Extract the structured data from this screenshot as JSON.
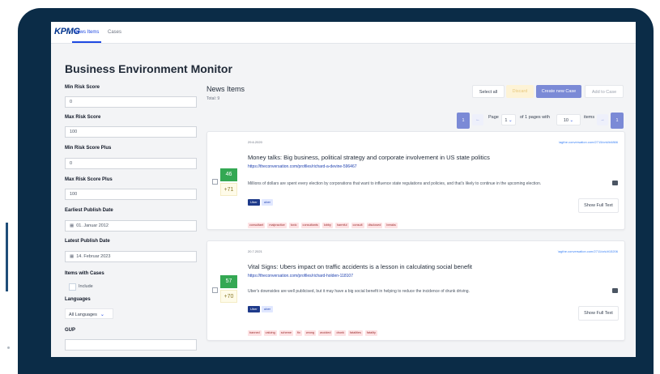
{
  "nav": {
    "logo": "KPMG",
    "tabs": [
      "News Items",
      "Cases"
    ]
  },
  "page_title": "Business Environment Monitor",
  "filters": {
    "min_risk_label": "Min Risk Score",
    "min_risk_value": "0",
    "max_risk_label": "Max Risk Score",
    "max_risk_value": "100",
    "min_risk_plus_label": "Min Risk Score Plus",
    "min_risk_plus_value": "0",
    "max_risk_plus_label": "Max Risk Score Plus",
    "max_risk_plus_value": "100",
    "earliest_label": "Earliest Publish Date",
    "earliest_value": "01. Januar 2012",
    "latest_label": "Latest Publish Date",
    "latest_value": "14. Februar 2023",
    "cases_label": "Items with Cases",
    "include_label": "Include",
    "languages_label": "Languages",
    "languages_value": "All Languages",
    "gup_label": "GUP"
  },
  "news": {
    "heading": "News Items",
    "total": "Total: 9",
    "buttons": {
      "select_all": "Select all",
      "discard": "Discard",
      "create_case": "Create new Case",
      "add_to_case": "Add to Case"
    },
    "pager": {
      "page_word": "Page",
      "page_value": "1",
      "of_text": "of 1 pages with",
      "per_page": "10",
      "items_word": "items",
      "num": "1",
      "prev": "←",
      "next": "→"
    },
    "items": [
      {
        "date": "29.6.2020",
        "link": "\\agthe.conversation.com/2715/crkl/#4866",
        "title": "Money talks: Big business, political strategy and corporate involvement in US state politics",
        "author": "https://theconversation.com/profiles/richard-a-devine-596467",
        "desc": "Millions of dollars are spent every election by corporations that want to influence state regulations and policies, and that's likely to continue in the upcoming election.",
        "score": "46",
        "score_plus": "+71",
        "chips": [
          "Uber",
          "uber"
        ],
        "tags": [
          "consultant",
          "malpractice",
          "toxic",
          "consultants",
          "lobby",
          "harmful",
          "consult",
          "disclosed",
          "breaks"
        ],
        "show_full": "Show Full Text"
      },
      {
        "date": "20.7.2021",
        "link": "\\agthe.conversation.com/2711/crk/#15206",
        "title": "Vital Signs: Ubers impact on traffic accidents is a lesson in calculating social benefit",
        "author": "https://theconversation.com/profiles/richard-holden-118107",
        "desc": "Uber's downsides are well publicised, but it may have a big social benefit in helping to reduce the incidence of drunk driving.",
        "score": "57",
        "score_plus": "+70",
        "chips": [
          "Uber",
          "uber"
        ],
        "tags": [
          "banned",
          "valuing",
          "scheme",
          "fix",
          "wrong",
          "avoided",
          "drunk",
          "fatalities",
          "fatality"
        ],
        "show_full": "Show Full Text"
      }
    ]
  },
  "colors": {
    "frame": "#0b2c47",
    "brand": "#00338d",
    "accent": "#1e49e2",
    "score_green": "#34a853"
  }
}
